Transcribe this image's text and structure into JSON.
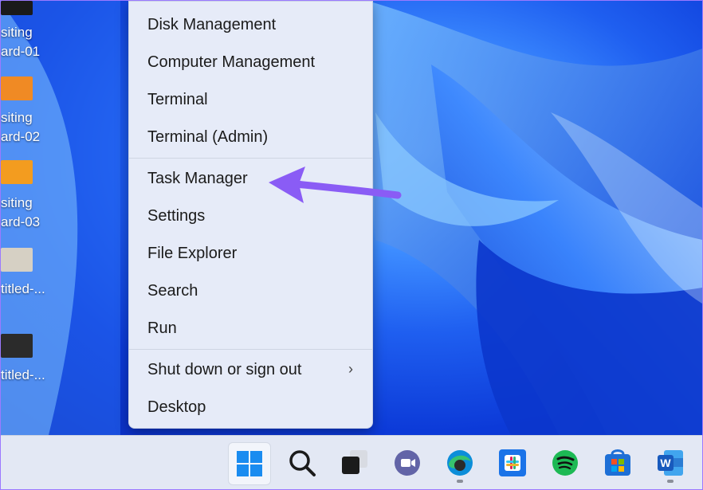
{
  "desktop": {
    "icons": [
      {
        "label1": "siting",
        "label2": "ard-01",
        "icon": "presentation-file-icon"
      },
      {
        "label1": "siting",
        "label2": "ard-02",
        "icon": "presentation-file-icon"
      },
      {
        "label1": "siting",
        "label2": "ard-03",
        "icon": "presentation-file-icon"
      },
      {
        "label1": "titled-...",
        "label2": "",
        "icon": "image-file-icon"
      },
      {
        "label1": "titled-...",
        "label2": "",
        "icon": "image-file-icon"
      }
    ]
  },
  "context_menu": {
    "items": [
      {
        "label": "Disk Management"
      },
      {
        "label": "Computer Management"
      },
      {
        "label": "Terminal"
      },
      {
        "label": "Terminal (Admin)"
      },
      {
        "label": "Task Manager"
      },
      {
        "label": "Settings"
      },
      {
        "label": "File Explorer"
      },
      {
        "label": "Search"
      },
      {
        "label": "Run"
      },
      {
        "label": "Shut down or sign out",
        "submenu": true
      },
      {
        "label": "Desktop"
      }
    ]
  },
  "annotation": {
    "color": "#8a5cf5",
    "points_to": "Task Manager"
  },
  "taskbar": {
    "apps": [
      {
        "name": "start-icon",
        "color": "#1a73e8"
      },
      {
        "name": "search-icon",
        "color": "#1b1b1b"
      },
      {
        "name": "task-view-icon",
        "color": "#1b1b1b"
      },
      {
        "name": "teams-chat-icon",
        "color": "#6264a7"
      },
      {
        "name": "edge-icon",
        "color": "#0c8ed9"
      },
      {
        "name": "slack-icon",
        "color": "#1a73e8"
      },
      {
        "name": "spotify-icon",
        "color": "#1db954"
      },
      {
        "name": "microsoft-store-icon",
        "color": "#0067b8"
      },
      {
        "name": "word-icon",
        "color": "#185abd"
      }
    ]
  }
}
